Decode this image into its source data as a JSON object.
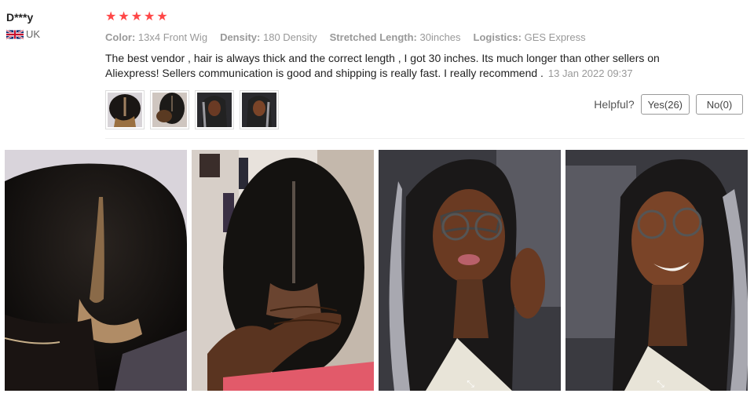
{
  "reviewer": {
    "name": "D***y",
    "country_code": "UK",
    "flag_icon": "uk-flag-icon"
  },
  "rating": {
    "stars": 5,
    "star_color": "#ff4747"
  },
  "specs": [
    {
      "label": "Color:",
      "value": "13x4 Front Wig"
    },
    {
      "label": "Density:",
      "value": "180 Density"
    },
    {
      "label": "Stretched Length:",
      "value": "30inches"
    },
    {
      "label": "Logistics:",
      "value": "GES Express"
    }
  ],
  "review": {
    "text": "The best vendor , hair is always thick and the correct length , I got 30 inches. Its much longer than other sellers on Aliexpress! Sellers communication is good and shipping is really fast. I really recommend .",
    "date": "13 Jan 2022 09:37"
  },
  "helpful": {
    "label": "Helpful?",
    "yes_label": "Yes(26)",
    "no_label": "No(0)"
  },
  "thumbnails": [
    "scalp-part-thumb",
    "hand-part-thumb",
    "model-glasses-thumb",
    "model-smile-thumb"
  ],
  "photos": [
    "scalp-part-photo",
    "hand-part-photo",
    "model-glasses-photo",
    "model-smile-photo"
  ]
}
